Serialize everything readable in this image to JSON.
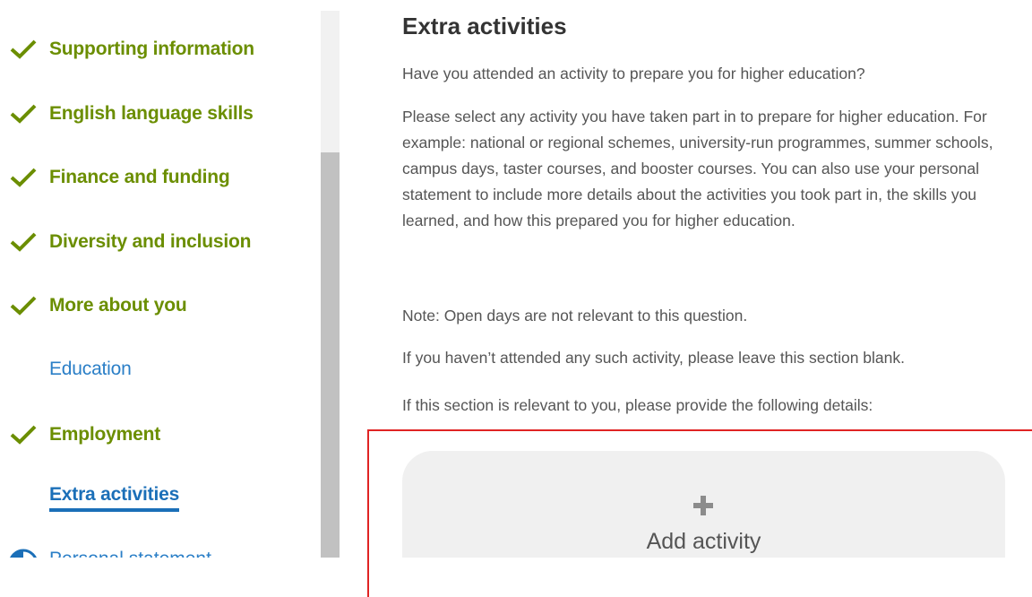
{
  "sidebar": {
    "items": [
      {
        "label": "Supporting information",
        "status": "complete"
      },
      {
        "label": "English language skills",
        "status": "complete"
      },
      {
        "label": "Finance and funding",
        "status": "complete"
      },
      {
        "label": "Diversity and inclusion",
        "status": "complete"
      },
      {
        "label": "More about you",
        "status": "complete"
      },
      {
        "label": "Education",
        "status": "incomplete"
      },
      {
        "label": "Employment",
        "status": "complete"
      },
      {
        "label": "Extra activities",
        "status": "current"
      },
      {
        "label": "Personal statement",
        "status": "in-progress"
      }
    ],
    "check_icon": "checkmark-icon",
    "progress_icon": "half-circle-icon",
    "colors": {
      "complete": "#6b8e00",
      "link": "#2b7fc7",
      "current": "#1b6fb8"
    }
  },
  "main": {
    "title": "Extra activities",
    "question": "Have you attended an activity to prepare you for higher education?",
    "description": "Please select any activity you have taken part in to prepare for higher education. For example: national or regional schemes, university-run programmes, summer schools, campus days, taster courses, and booster courses. You can also use your personal statement to include more details about the activities you took part in, the skills you learned, and how this prepared you for higher education.",
    "note": "Note: Open days are not relevant to this question.",
    "blank_hint": "If you haven’t attended any such activity, please leave this section blank.",
    "details_hint": "If this section is relevant to you, please provide the following details:",
    "add_activity": {
      "label": "Add activity",
      "icon": "plus-icon"
    }
  },
  "colors": {
    "highlight_border": "#e02424",
    "card_background": "#f0f0f0",
    "scrollbar_thumb": "#c1c1c1"
  }
}
